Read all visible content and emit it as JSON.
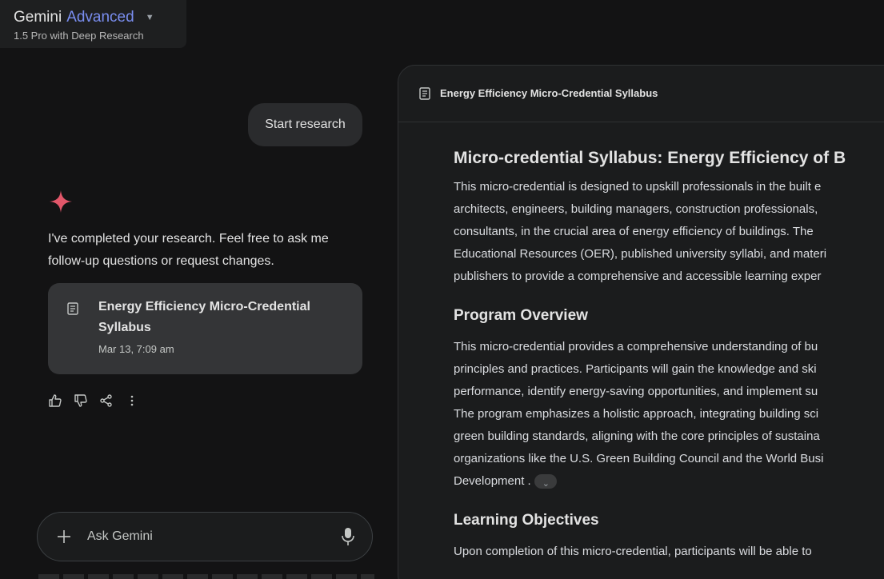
{
  "header": {
    "model_name": "Gemini",
    "model_tier": "Advanced",
    "model_subtitle": "1.5 Pro with Deep Research"
  },
  "chat": {
    "user_message": "Start research",
    "reply_line1": "I've completed your research. Feel free to ask me",
    "reply_line2": "follow-up questions or request changes.",
    "card": {
      "title_line1": "Energy Efficiency Micro-Credential",
      "title_line2": "Syllabus",
      "date": "Mar 13, 7:09 am"
    },
    "input_placeholder": "Ask Gemini"
  },
  "document": {
    "header_title": "Energy Efficiency Micro-Credential Syllabus",
    "title": "Micro-credential Syllabus: Energy Efficiency of B",
    "intro_lines": [
      "This micro-credential is designed to upskill professionals in the built e",
      "architects, engineers, building managers, construction professionals,",
      "consultants, in the crucial area of energy efficiency of buildings. The",
      "Educational Resources (OER), published university syllabi, and materi",
      "publishers to provide a comprehensive and accessible learning exper"
    ],
    "section1_heading": "Program Overview",
    "section1_lines": [
      "This micro-credential provides a comprehensive understanding of bu",
      "principles and practices. Participants will gain the knowledge and ski",
      "performance, identify energy-saving opportunities, and implement su",
      "The program emphasizes a holistic approach, integrating building sci",
      "green building standards, aligning with the core principles of sustaina",
      "organizations like the U.S. Green Building Council and the World Busi",
      "Development ."
    ],
    "section2_heading": "Learning Objectives",
    "section2_partial": "Upon completion of this micro-credential, participants will be able to"
  },
  "colors": {
    "background": "#131314",
    "accent_tier": "#7a8ef0",
    "spark": "#e2576a"
  }
}
